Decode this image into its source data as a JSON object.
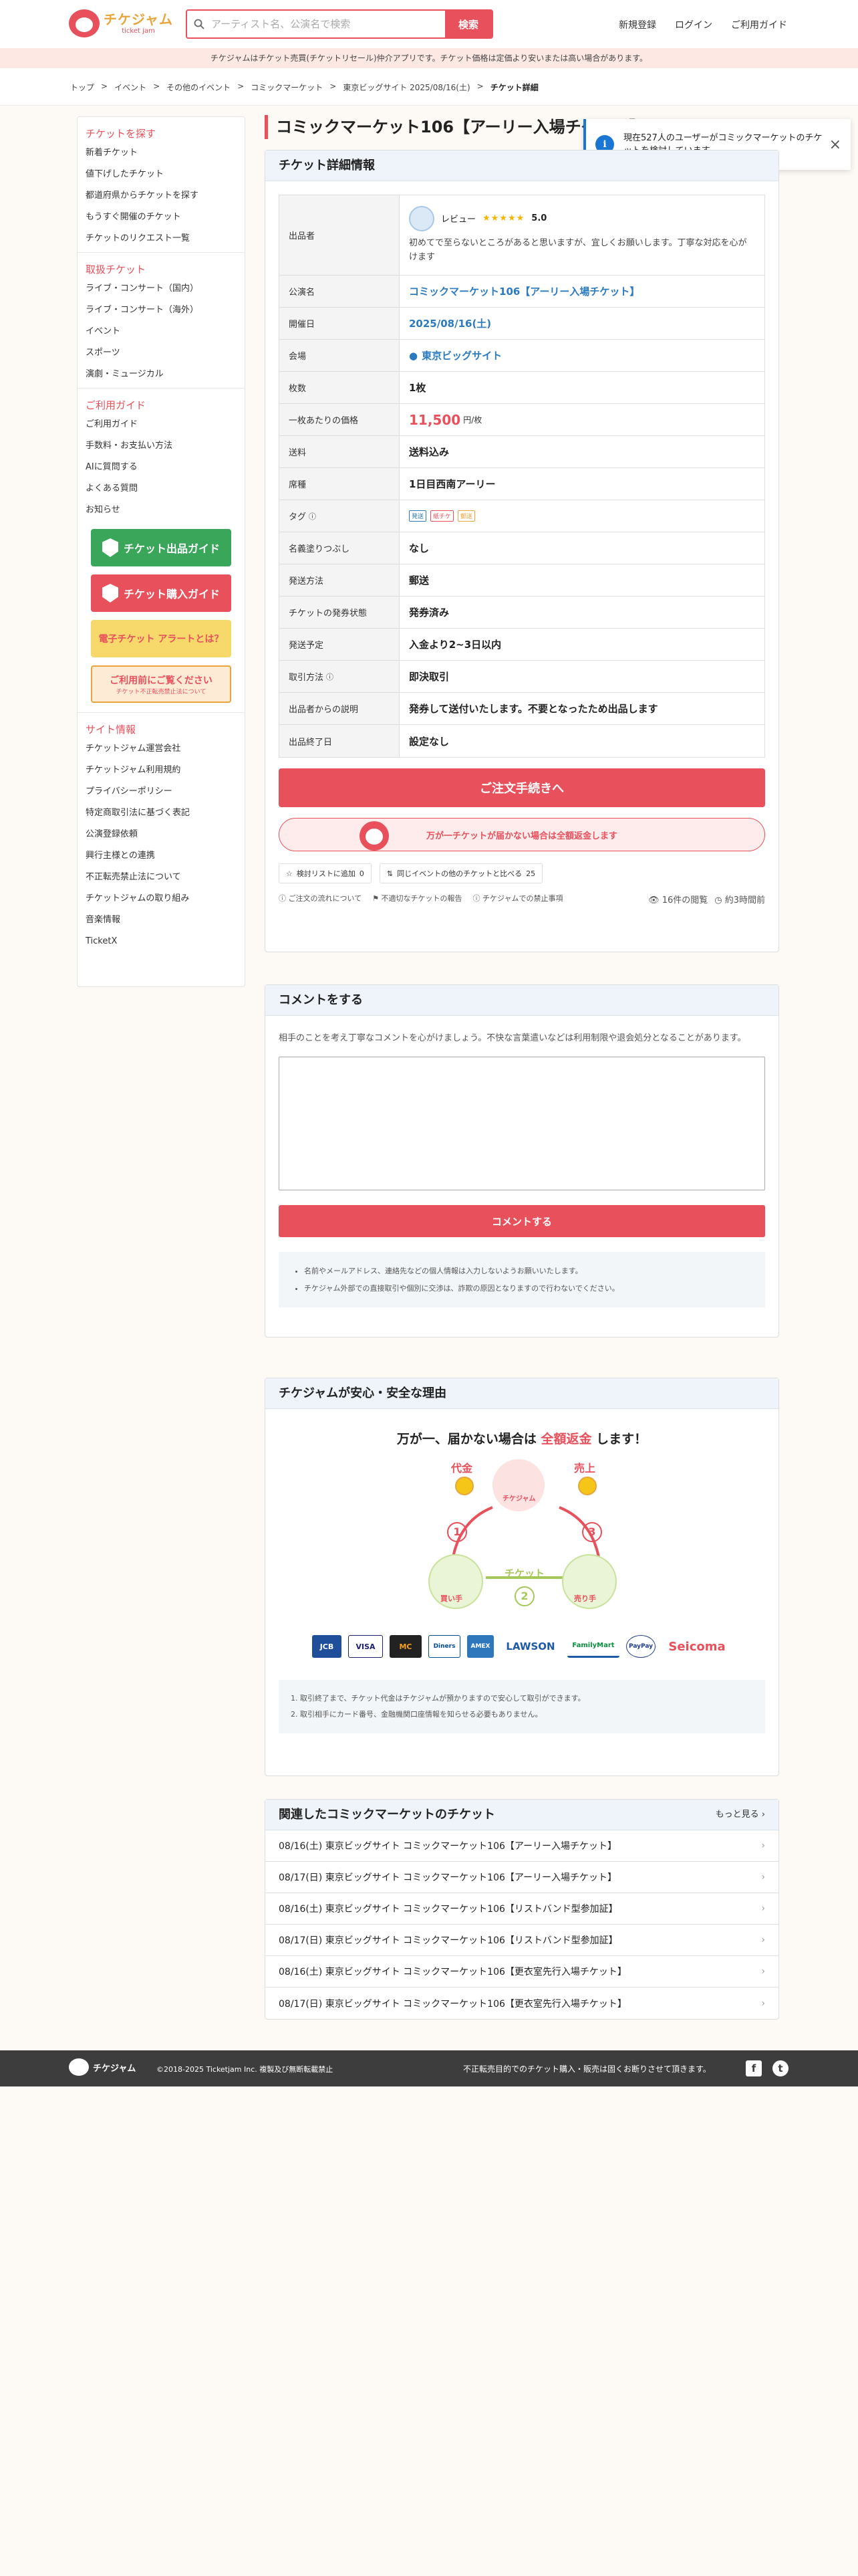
{
  "header": {
    "logo_main": "チケジャム",
    "logo_sub": "ticket jam",
    "search_placeholder": "アーティスト名、公演名で検索",
    "search_button": "検索",
    "nav": [
      "新規登録",
      "ログイン",
      "ご利用ガイド"
    ]
  },
  "notice": "チケジャムはチケット売買(チケットリセール)仲介アプリです。チケット価格は定価より安いまたは高い場合があります。",
  "breadcrumb": [
    "トップ",
    "イベント",
    "その他のイベント",
    "コミックマーケット",
    "東京ビッグサイト 2025/08/16(土)",
    "チケット詳細"
  ],
  "sidebar": {
    "sections": [
      {
        "title": "チケットを探す",
        "items": [
          "新着チケット",
          "値下げしたチケット",
          "都道府県からチケットを探す",
          "もうすぐ開催のチケット",
          "チケットのリクエスト一覧"
        ]
      },
      {
        "title": "取扱チケット",
        "items": [
          "ライブ・コンサート（国内）",
          "ライブ・コンサート（海外）",
          "イベント",
          "スポーツ",
          "演劇・ミュージカル"
        ]
      },
      {
        "title": "ご利用ガイド",
        "items": [
          "ご利用ガイド",
          "手数料・お支払い方法",
          "AIに質問する",
          "よくある質問",
          "お知らせ"
        ]
      }
    ],
    "banners": {
      "sell": "チケット出品ガイド",
      "buy": "チケット購入ガイド",
      "e_ticket": "電子チケット アラートとは？",
      "caution": "ご利用前にご覧ください",
      "caution_sub": "チケット不正転売禁止法について"
    },
    "site_info": {
      "title": "サイト情報",
      "items": [
        "チケットジャム運営会社",
        "チケットジャム利用規約",
        "プライバシーポリシー",
        "特定商取引法に基づく表記",
        "公演登録依頼",
        "興行主様との連携",
        "不正転売禁止法について",
        "チケットジャムの取り組み",
        "音楽情報",
        "TicketX"
      ]
    }
  },
  "main": {
    "title": "コミックマーケット106【アーリー入場チケット】",
    "toast": "現在527人のユーザーがコミックマーケットのチケットを検討しています。",
    "detail_heading": "チケット詳細情報",
    "seller": {
      "label": "出品者",
      "review_label": "レビュー",
      "stars": "★★★★★",
      "rating": "5.0",
      "desc": "初めてで至らないところがあると思いますが、宜しくお願いします。丁寧な対応を心がけます"
    },
    "rows": [
      {
        "k": "公演名",
        "v": "コミックマーケット106【アーリー入場チケット】"
      },
      {
        "k": "開催日",
        "v": "2025/08/16(土)"
      },
      {
        "k": "会場",
        "v": "東京ビッグサイト"
      },
      {
        "k": "枚数",
        "v": "1枚"
      },
      {
        "k": "一枚あたりの価格",
        "v": "11,500",
        "unit": "円/枚"
      },
      {
        "k": "送料",
        "v": "送料込み"
      },
      {
        "k": "席種",
        "v": "1日目西南アーリー"
      },
      {
        "k": "タグ",
        "tags": [
          "発送",
          "紙チケ",
          "郵送"
        ]
      },
      {
        "k": "名義塗りつぶし",
        "v": "なし"
      },
      {
        "k": "発送方法",
        "v": "郵送"
      },
      {
        "k": "チケットの発券状態",
        "v": "発券済み"
      },
      {
        "k": "発送予定",
        "v": "入金より2~3日以内"
      },
      {
        "k": "取引方法",
        "v": "即決取引"
      },
      {
        "k": "出品者からの説明",
        "v": "発券して送付いたします。不要となったため出品します"
      },
      {
        "k": "出品終了日",
        "v": "設定なし"
      }
    ],
    "order_button": "ご注文手続きへ",
    "refund_text": "万が一チケットが届かない場合は全額返金します",
    "wish_label": "検討リストに追加",
    "wish_count": "0",
    "compare_label": "同じイベントの他のチケットと比べる",
    "compare_count": "25",
    "links": [
      "ご注文の流れについて",
      "不適切なチケットの報告",
      "チケジャムでの禁止事項"
    ],
    "views": "16件の閲覧",
    "time": "約3時間前"
  },
  "comment": {
    "heading": "コメントをする",
    "desc": "相手のことを考え丁寧なコメントを心がけましょう。不快な言葉遣いなどは利用制限や退会処分となることがあります。",
    "button": "コメントする",
    "notes": [
      "名前やメールアドレス、連絡先などの個人情報は入力しないようお願いいたします。",
      "チケジャム外部での直接取引や個別に交渉は、詐欺の原因となりますので行わないでください。"
    ]
  },
  "safety": {
    "heading": "チケジャムが安心・安全な理由",
    "title_pre": "万が一、届かない場合は",
    "title_hl": "全額返金",
    "title_post": "します！",
    "flow_labels": {
      "pay": "代金",
      "sales": "売上",
      "ticket": "チケット",
      "center": "チケジャム",
      "buyer": "買い手",
      "seller": "売り手"
    },
    "payments": [
      "JCB",
      "VISA",
      "MC",
      "Diners",
      "AMEX",
      "LAWSON",
      "FamilyMart",
      "PayPay",
      "Seicoma"
    ],
    "notes": [
      "1. 取引終了まで、チケット代金はチケジャムが預かりますので安心して取引ができます。",
      "2. 取引相手にカード番号、金融機関口座情報を知らせる必要もありません。"
    ]
  },
  "related": {
    "heading": "関連したコミックマーケットのチケット",
    "more": "もっと見る",
    "items": [
      "08/16(土) 東京ビッグサイト コミックマーケット106【アーリー入場チケット】",
      "08/17(日) 東京ビッグサイト コミックマーケット106【アーリー入場チケット】",
      "08/16(土) 東京ビッグサイト コミックマーケット106【リストバンド型参加証】",
      "08/17(日) 東京ビッグサイト コミックマーケット106【リストバンド型参加証】",
      "08/16(土) 東京ビッグサイト コミックマーケット106【更衣室先行入場チケット】",
      "08/17(日) 東京ビッグサイト コミックマーケット106【更衣室先行入場チケット】"
    ]
  },
  "footer": {
    "logo": "チケジャム",
    "copyright": "©2018-2025 Ticketjam Inc. 複製及び無断転載禁止",
    "note": "不正転売目的でのチケット購入・販売は固くお断りさせて頂きます。",
    "social": [
      "f",
      "t"
    ]
  },
  "colors": {
    "accent": "#e8505b",
    "link": "#2a7ac2",
    "info": "#1976d2",
    "green": "#3aa65a"
  }
}
